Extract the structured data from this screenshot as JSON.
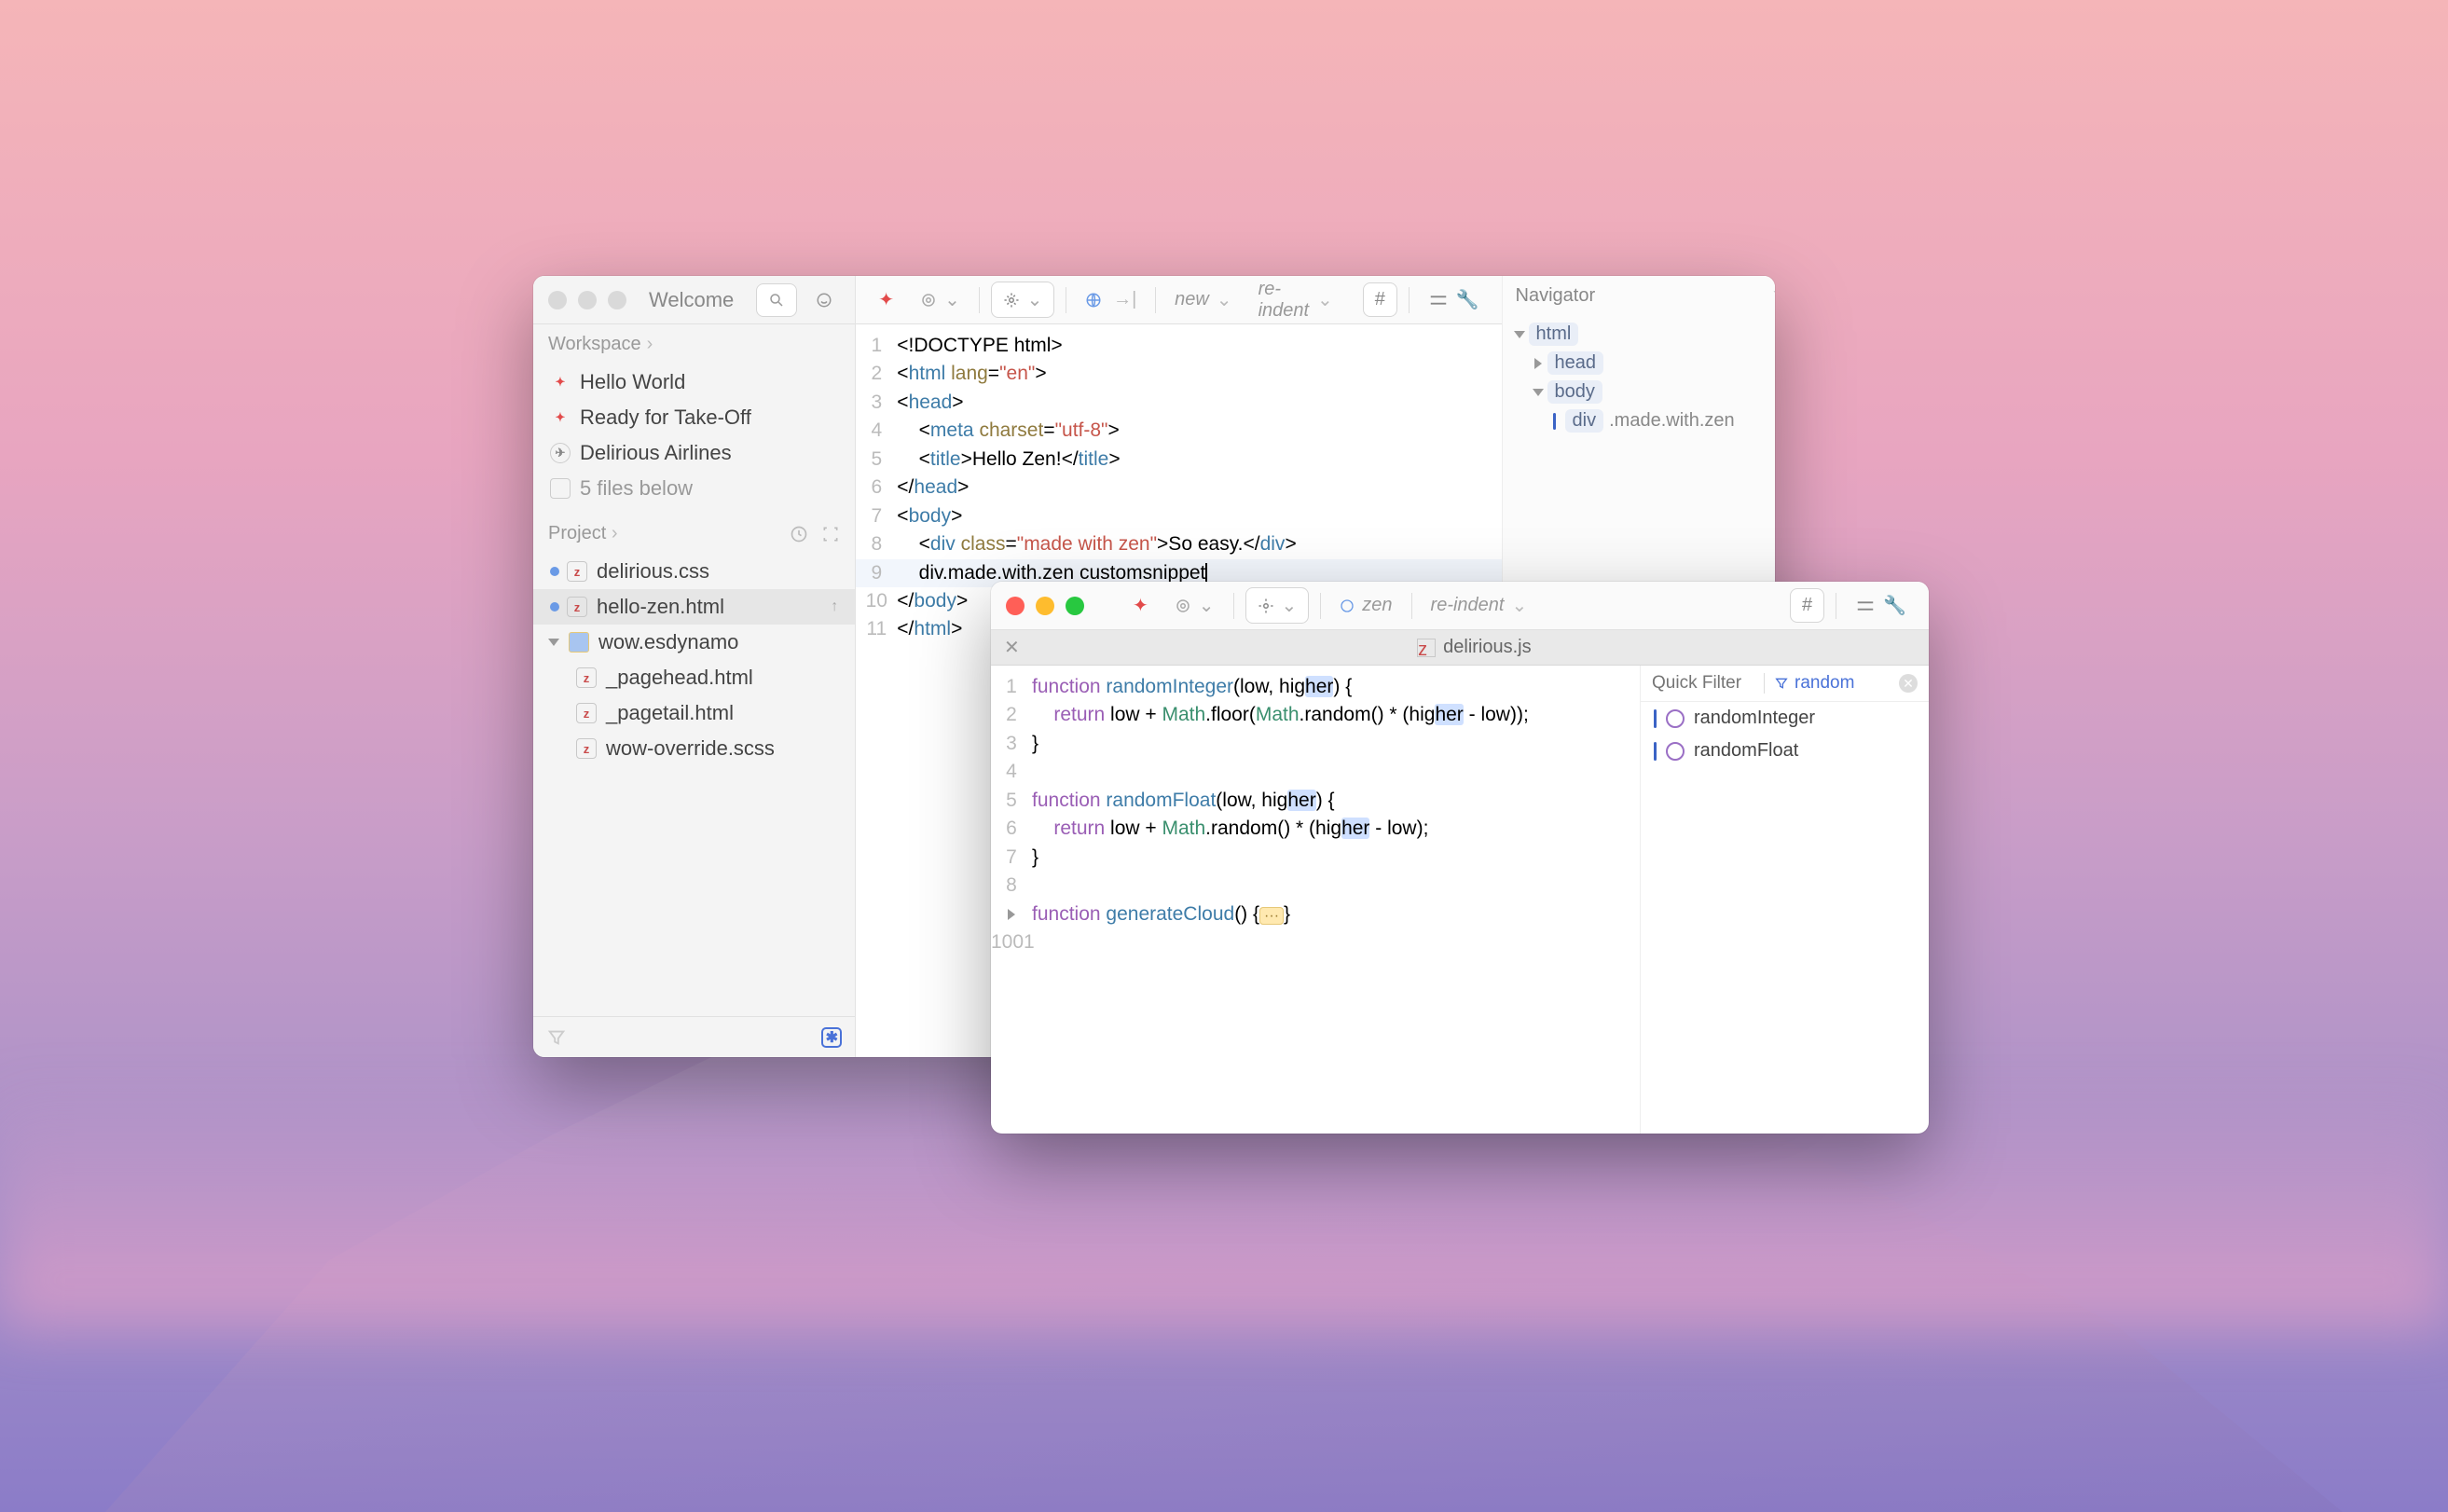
{
  "window1": {
    "title": "Welcome",
    "workspace_label": "Workspace",
    "workspace_items": [
      "Hello World",
      "Ready for Take-Off",
      "Delirious Airlines"
    ],
    "files_below": "5 files below",
    "project_label": "Project",
    "project_items": [
      {
        "name": "delirious.css",
        "icon": "z",
        "mod": true
      },
      {
        "name": "hello-zen.html",
        "icon": "z",
        "mod": true,
        "sel": true,
        "pin": "↑"
      },
      {
        "name": "wow.esdynamo",
        "icon": "fold",
        "mod": false,
        "folder": true
      },
      {
        "name": "_pagehead.html",
        "icon": "z",
        "indent": true
      },
      {
        "name": "_pagetail.html",
        "icon": "z",
        "indent": true
      },
      {
        "name": "wow-override.scss",
        "icon": "z",
        "indent": true
      }
    ],
    "toolbar": {
      "new": "new",
      "reindent": "re-indent"
    },
    "code_lines": [
      {
        "n": "1",
        "html": "&lt;!DOCTYPE html&gt;"
      },
      {
        "n": "2",
        "html": "&lt;<span class=tg>html</span> <span class=at>lang</span>=<span class=st>\"en\"</span>&gt;"
      },
      {
        "n": "3",
        "html": "&lt;<span class=tg>head</span>&gt;"
      },
      {
        "n": "4",
        "html": "    &lt;<span class=tg>meta</span> <span class=at>charset</span>=<span class=st>\"utf-8\"</span>&gt;"
      },
      {
        "n": "5",
        "html": "    &lt;<span class=tg>title</span>&gt;Hello Zen!&lt;/<span class=tg>title</span>&gt;"
      },
      {
        "n": "6",
        "html": "&lt;/<span class=tg>head</span>&gt;"
      },
      {
        "n": "7",
        "html": "&lt;<span class=tg>body</span>&gt;"
      },
      {
        "n": "8",
        "html": "    &lt;<span class=tg>div</span> <span class=at>class</span>=<span class=st>\"made with zen\"</span>&gt;So easy.&lt;/<span class=tg>div</span>&gt;"
      },
      {
        "n": "9",
        "html": "    div.made.with.zen customsnippet<span class=caret></span>",
        "cur": true
      },
      {
        "n": "10",
        "html": "&lt;/<span class=tg>body</span>&gt;"
      },
      {
        "n": "11",
        "html": "&lt;/<span class=tg>html</span>&gt;"
      }
    ],
    "navigator_label": "Navigator",
    "navigator": [
      {
        "lv": 0,
        "label": "html",
        "open": true
      },
      {
        "lv": 1,
        "label": "head",
        "open": false
      },
      {
        "lv": 1,
        "label": "body",
        "open": true
      },
      {
        "lv": 2,
        "label": "div",
        "suffix": ".made.with.zen",
        "cur": true
      }
    ]
  },
  "window2": {
    "toolbar": {
      "zen": "zen",
      "reindent": "re-indent"
    },
    "tab_title": "delirious.js",
    "code_lines": [
      {
        "n": "1",
        "html": "<span class=kw>function</span> <span class=fn>randomInteger</span>(low, hig<span class=hl>her</span>) {"
      },
      {
        "n": "2",
        "html": "    <span class=kw>return</span> low + <span class=mth>Math</span>.floor(<span class=mth>Math</span>.random() * (hig<span class=hl>her</span> - low));"
      },
      {
        "n": "3",
        "html": "}"
      },
      {
        "n": "4",
        "html": ""
      },
      {
        "n": "5",
        "html": "<span class=kw>function</span> <span class=fn>randomFloat</span>(low, hig<span class=hl>her</span>) {"
      },
      {
        "n": "6",
        "html": "    <span class=kw>return</span> low + <span class=mth>Math</span>.random() * (hig<span class=hl>her</span> - low);"
      },
      {
        "n": "7",
        "html": "}"
      },
      {
        "n": "8",
        "html": ""
      },
      {
        "n": "9",
        "html": "<span class=kw>function</span> <span class=fn>generateCloud</span>() {<span class=fold>···</span>}",
        "fold": true
      },
      {
        "n": "1001",
        "html": ""
      }
    ],
    "quick_filter_label": "Quick Filter",
    "quick_filter_value": "random",
    "symbols": [
      "randomInteger",
      "randomFloat"
    ]
  }
}
